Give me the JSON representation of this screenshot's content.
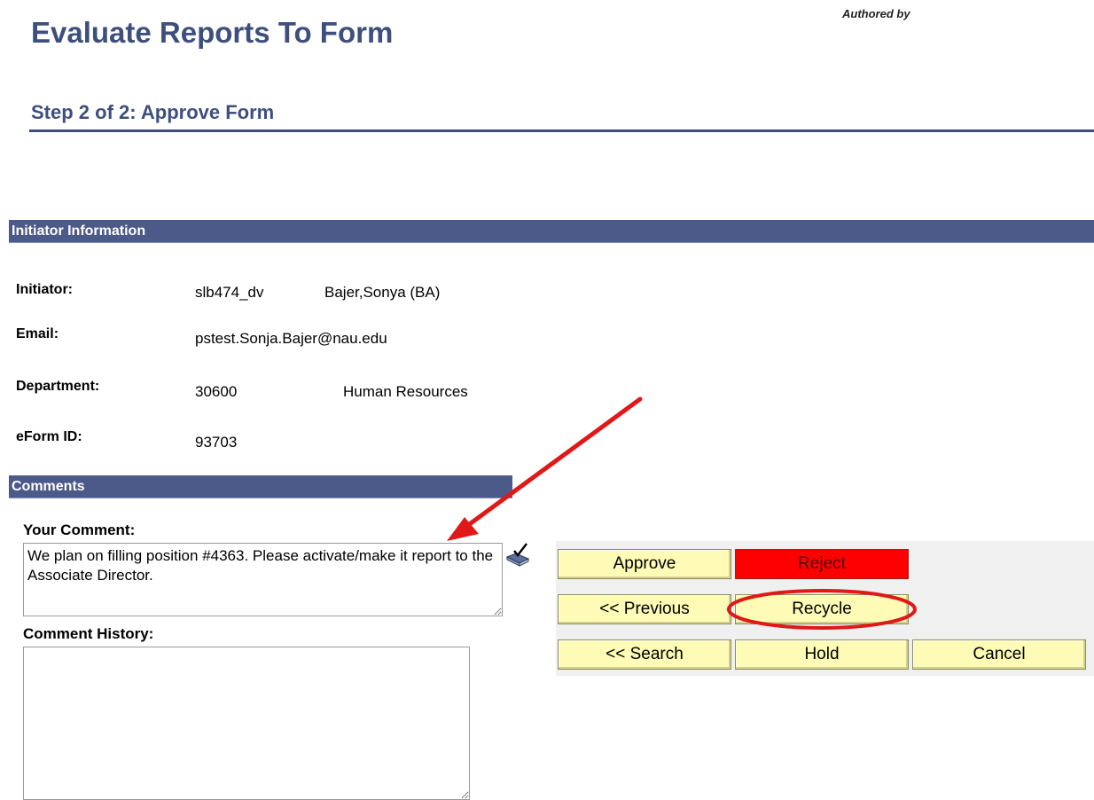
{
  "header": {
    "authored_by": "Authored by",
    "title": "Evaluate Reports To Form",
    "step": "Step 2 of 2: Approve Form"
  },
  "initiator_section": {
    "heading": "Initiator Information",
    "rows": [
      {
        "label": "Initiator:",
        "value": "slb474_dv",
        "extra": "Bajer,Sonya (BA)"
      },
      {
        "label": "Email:",
        "value": "pstest.Sonja.Bajer@nau.edu"
      },
      {
        "label": "Department:",
        "value": "30600",
        "extra": "Human Resources"
      },
      {
        "label": "eForm ID:",
        "value": "93703"
      }
    ]
  },
  "comments_section": {
    "heading": "Comments",
    "your_comment_label": "Your Comment:",
    "your_comment_value": "We plan on filling position #4363. Please activate/make it report to the Associate Director.",
    "history_label": "Comment History:",
    "history_value": ""
  },
  "buttons": {
    "approve": "Approve",
    "reject": "Reject",
    "previous": "<< Previous",
    "recycle": "Recycle",
    "search": "<< Search",
    "hold": "Hold",
    "cancel": "Cancel"
  },
  "icons": {
    "spell_check": "spell-check-icon"
  },
  "colors": {
    "title": "#3d4f7d",
    "section_bar": "#4c5a8a",
    "button": "#fdfbb5",
    "reject_button": "#ff0000",
    "annotation": "#e01818"
  }
}
